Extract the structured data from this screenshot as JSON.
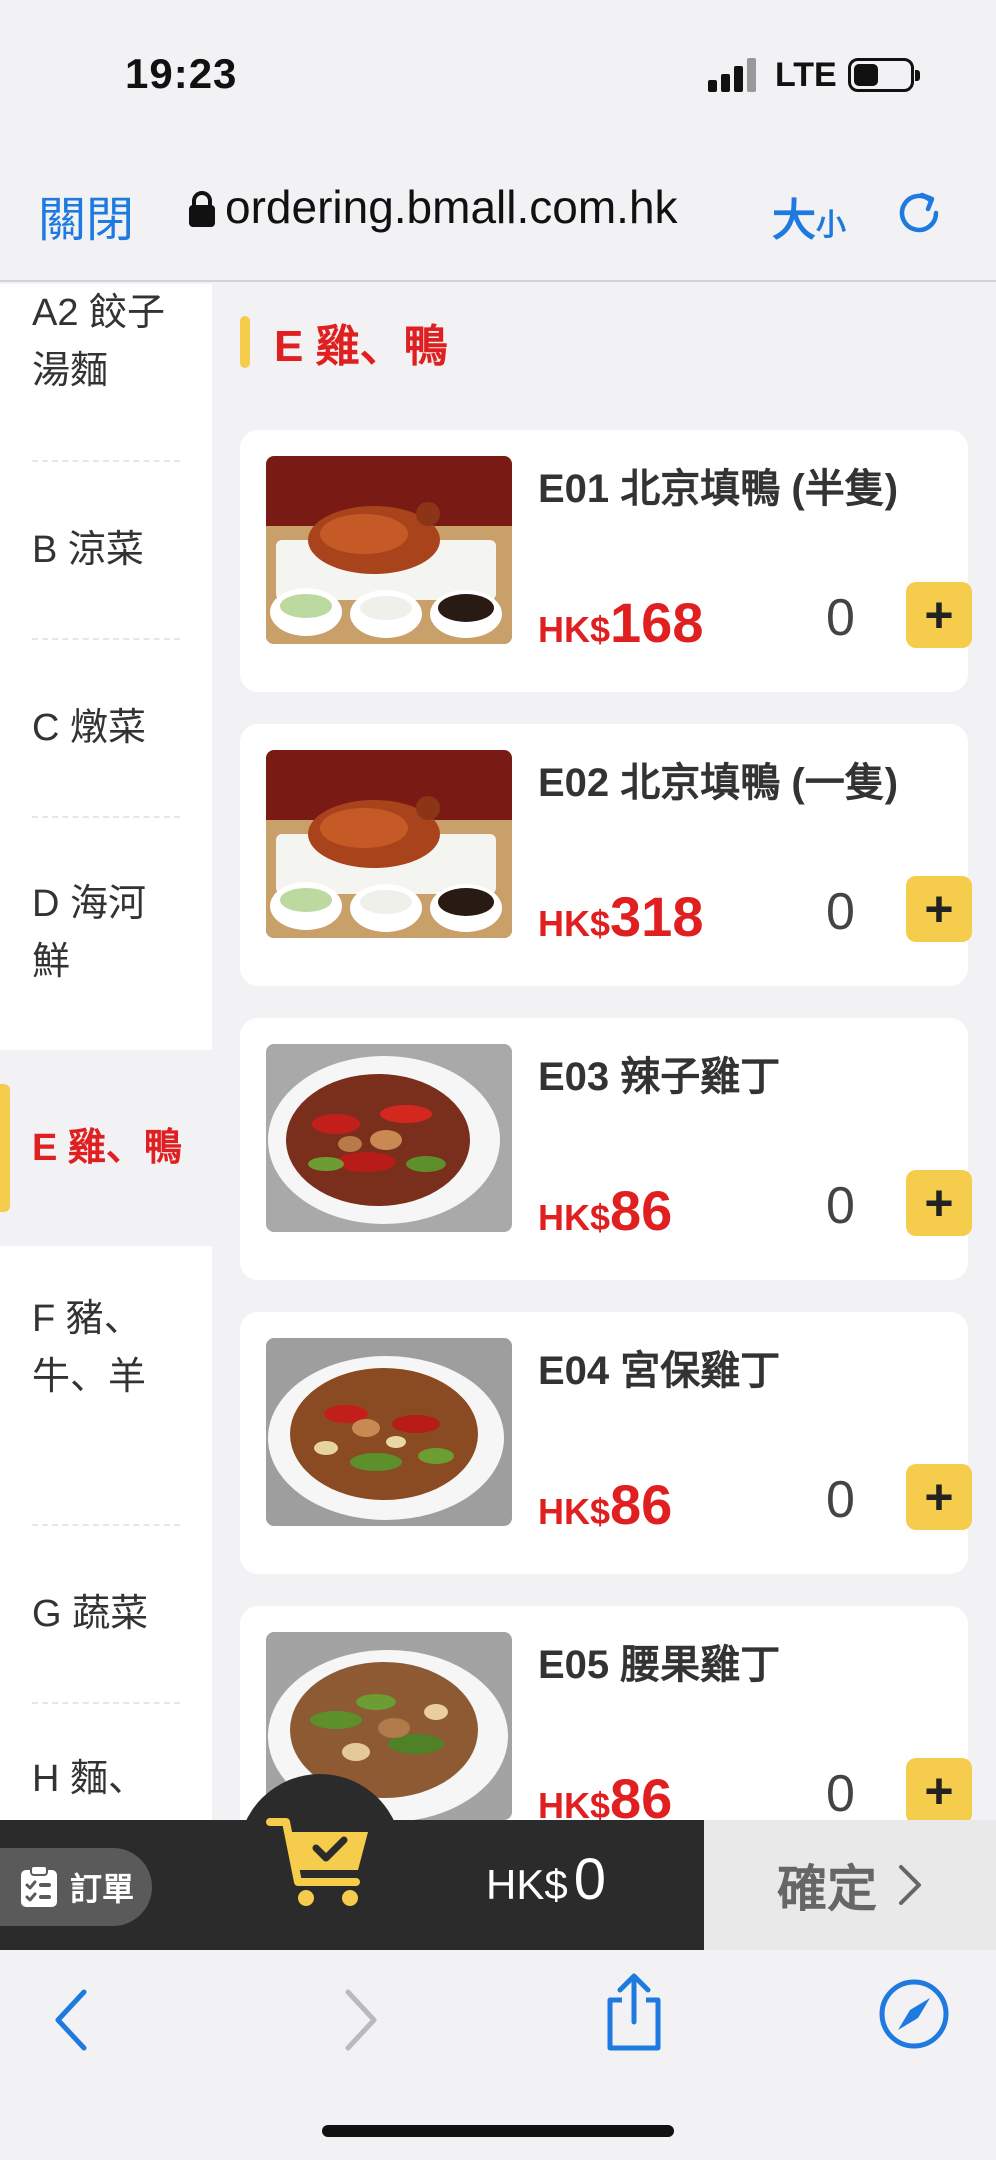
{
  "status_bar": {
    "time": "19:23",
    "network": "LTE",
    "battery_level": 0.45
  },
  "browser": {
    "close_label": "關閉",
    "url": "ordering.bmall.com.hk",
    "text_size_big": "大",
    "text_size_small": "小"
  },
  "sidebar": {
    "categories": [
      {
        "label": "A2 餃子湯麵"
      },
      {
        "label": "B 涼菜"
      },
      {
        "label": "C 燉菜"
      },
      {
        "label": "D 海河鮮"
      },
      {
        "label": "E 雞、鴨",
        "active": true
      },
      {
        "label": "F 豬、牛、羊"
      },
      {
        "label": "G 蔬菜"
      },
      {
        "label": "H 麵、"
      }
    ]
  },
  "section": {
    "title": "E 雞、鴨"
  },
  "dishes": [
    {
      "name": "E01 北京填鴨 (半隻)",
      "currency": "HK$",
      "price": "168",
      "qty": "0"
    },
    {
      "name": "E02 北京填鴨 (一隻)",
      "currency": "HK$",
      "price": "318",
      "qty": "0"
    },
    {
      "name": "E03 辣子雞丁",
      "currency": "HK$",
      "price": "86",
      "qty": "0"
    },
    {
      "name": "E04 宮保雞丁",
      "currency": "HK$",
      "price": "86",
      "qty": "0"
    },
    {
      "name": "E05 腰果雞丁",
      "currency": "HK$",
      "price": "86",
      "qty": "0"
    }
  ],
  "add_label": "+",
  "cart": {
    "order_label": "訂單",
    "currency": "HK$",
    "total": "0",
    "confirm_label": "確定"
  },
  "colors": {
    "accent_yellow": "#f5cc4b",
    "price_red": "#e02020",
    "link_blue": "#1f7ae0"
  }
}
